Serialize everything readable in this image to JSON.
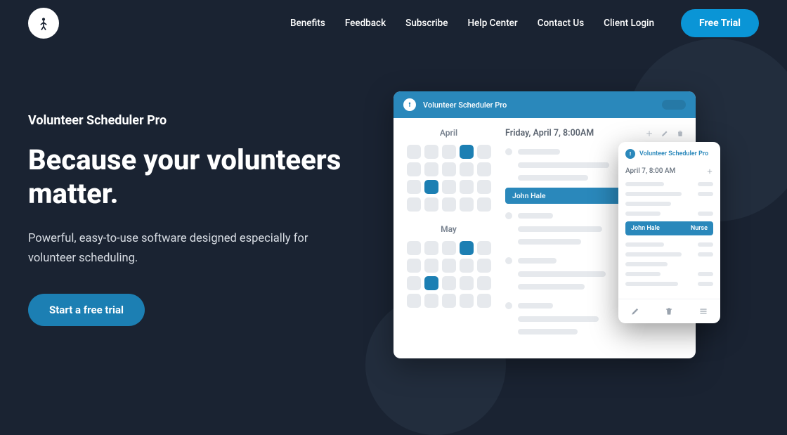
{
  "nav": {
    "links": [
      "Benefits",
      "Feedback",
      "Subscribe",
      "Help Center",
      "Contact Us",
      "Client Login"
    ],
    "cta": "Free Trial"
  },
  "hero": {
    "brand": "Volunteer Scheduler Pro",
    "headline": "Because your volunteers matter.",
    "subhead": "Powerful, easy-to-use software designed especially for volunteer scheduling.",
    "cta": "Start a free trial"
  },
  "mockup": {
    "app_name": "Volunteer Scheduler Pro",
    "month1": "April",
    "month2": "May",
    "detail_title": "Friday, April 7, 8:00AM",
    "person_name": "John Hale",
    "person_role": "Nurse",
    "mobile_date": "April 7, 8:00 AM"
  }
}
